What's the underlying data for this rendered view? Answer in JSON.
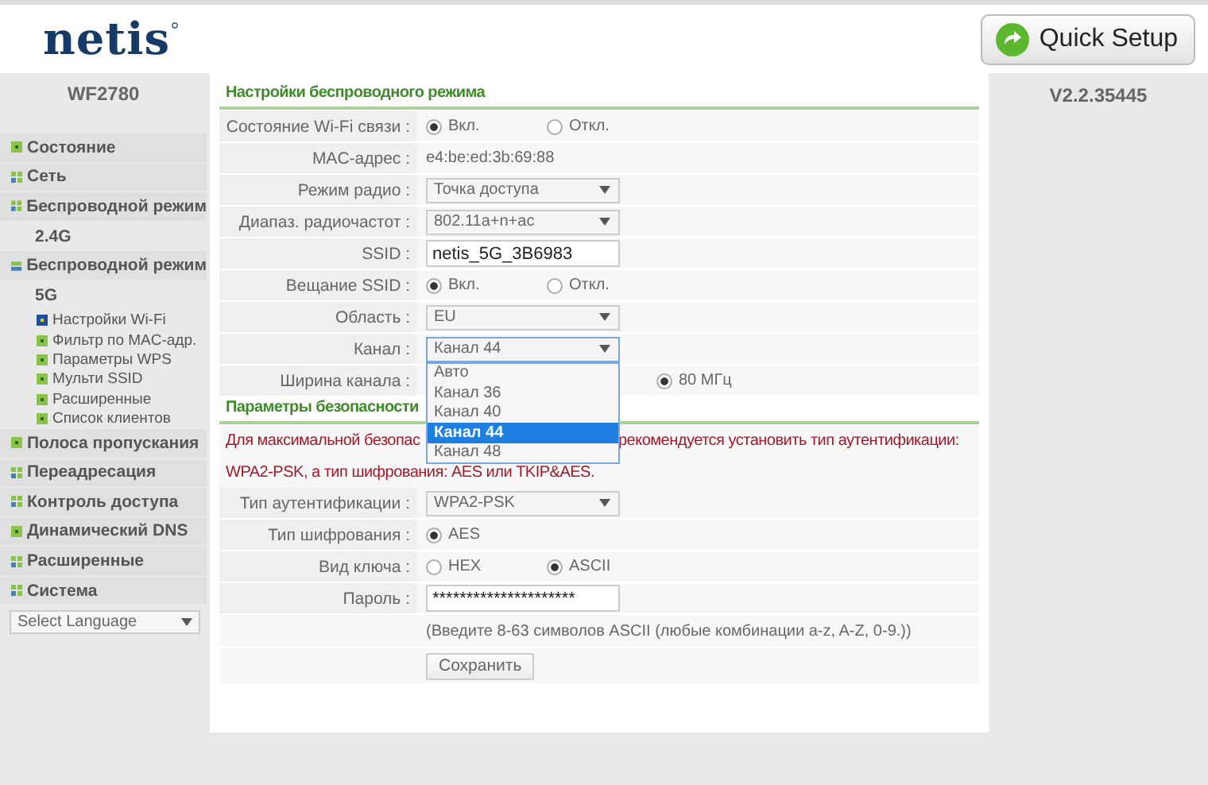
{
  "header": {
    "logo": "netis",
    "quick_setup": "Quick Setup"
  },
  "sidebar": {
    "model": "WF2780",
    "items": [
      {
        "label": "Состояние",
        "kind": "dot"
      },
      {
        "label": "Сеть",
        "kind": "grid"
      },
      {
        "label": "Беспроводной режим",
        "kind": "grid",
        "children": [
          {
            "label": "2.4G"
          }
        ]
      },
      {
        "label": "Беспроводной режим",
        "kind": "bar",
        "children": [
          {
            "label": "5G",
            "children": [
              {
                "label": "Настройки Wi-Fi",
                "selected": true
              },
              {
                "label": "Фильтр по MAC-адр.",
                "selected": false
              },
              {
                "label": "Параметры WPS",
                "selected": false
              },
              {
                "label": "Мульти SSID",
                "selected": false
              },
              {
                "label": "Расширенные",
                "selected": false
              },
              {
                "label": "Список клиентов",
                "selected": false
              }
            ]
          }
        ]
      },
      {
        "label": "Полоса пропускания",
        "kind": "dot"
      },
      {
        "label": "Переадресация",
        "kind": "grid"
      },
      {
        "label": "Контроль доступа",
        "kind": "grid"
      },
      {
        "label": "Динамический DNS",
        "kind": "dot"
      },
      {
        "label": "Расширенные",
        "kind": "grid"
      },
      {
        "label": "Система",
        "kind": "grid"
      }
    ],
    "language_select": "Select Language"
  },
  "version": "V2.2.35445",
  "wireless": {
    "title": "Настройки беспроводного режима",
    "rows": [
      {
        "kind": "radio",
        "label": "Состояние Wi-Fi связи :",
        "options": [
          {
            "label": "Вкл.",
            "selected": true
          },
          {
            "label": "Откл.",
            "selected": false
          }
        ]
      },
      {
        "kind": "text",
        "label": "MAC-адрес :",
        "value": "e4:be:ed:3b:69:88"
      },
      {
        "kind": "select",
        "label": "Режим радио :",
        "value": "Точка доступа"
      },
      {
        "kind": "select",
        "label": "Диапаз. радиочастот :",
        "value": "802.11a+n+ac"
      },
      {
        "kind": "input",
        "label": "SSID :",
        "value": "netis_5G_3B6983"
      },
      {
        "kind": "radio",
        "label": "Вещание SSID :",
        "options": [
          {
            "label": "Вкл.",
            "selected": true
          },
          {
            "label": "Откл.",
            "selected": false
          }
        ]
      },
      {
        "kind": "select",
        "label": "Область :",
        "value": "EU"
      },
      {
        "kind": "select",
        "label": "Канал :",
        "value": "Канал 44",
        "open": true,
        "options": [
          {
            "label": "Авто",
            "selected": false
          },
          {
            "label": "Канал 36",
            "selected": false
          },
          {
            "label": "Канал 40",
            "selected": false
          },
          {
            "label": "Канал 44",
            "selected": true
          },
          {
            "label": "Канал 48",
            "selected": false
          }
        ]
      },
      {
        "kind": "radio",
        "label": "Ширина канала :",
        "covered": true,
        "options": [
          {
            "label": "80 МГц",
            "selected": true
          }
        ]
      }
    ]
  },
  "security": {
    "title": "Параметры безопасности",
    "warning": [
      {
        "segments": [
          "Для максимальной безопас",
          "рекомендуется установить тип аутентификации:"
        ]
      },
      {
        "segments": [
          "WPA2-PSK, а тип шифрования: AES или TKIP&AES."
        ]
      }
    ],
    "rows": [
      {
        "kind": "select",
        "label": "Тип аутентификации :",
        "value": "WPA2-PSK"
      },
      {
        "kind": "radio",
        "label": "Тип шифрования :",
        "options": [
          {
            "label": "AES",
            "selected": true
          }
        ]
      },
      {
        "kind": "radio",
        "label": "Вид ключа :",
        "options": [
          {
            "label": "HEX",
            "selected": false
          },
          {
            "label": "ASCII",
            "selected": true
          }
        ]
      },
      {
        "kind": "input",
        "label": "Пароль :",
        "value": "*********************"
      }
    ],
    "hint": "(Введите 8-63 символов ASCII (любые комбинации a-z, A-Z, 0-9.))",
    "save": "Сохранить"
  }
}
